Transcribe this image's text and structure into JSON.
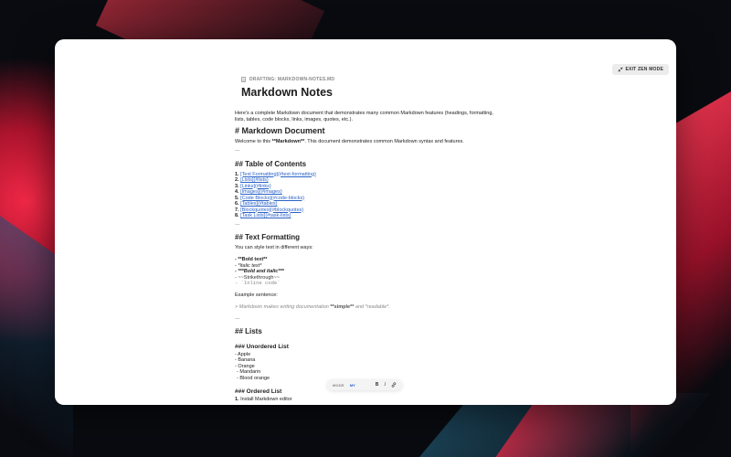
{
  "zen": {
    "label": "EXIT ZEN MODE",
    "icon": "collapse-icon"
  },
  "doc": {
    "drafting": "DRAFTING: MARKDOWN-NOTES.MD",
    "title": "Markdown Notes",
    "intro": "Here's a complete Markdown document that demonstrates many common Markdown features (headings, formatting, lists, tables, code blocks, links, images, quotes, etc.).",
    "h1": "# Markdown Document",
    "welcome_pre": "Welcome to this ",
    "welcome_bold": "**Markdown**",
    "welcome_post": ". This document demonstrates common Markdown syntax and features.",
    "hr": "---",
    "toc_heading": "## Table of Contents",
    "toc": [
      {
        "num": "1.",
        "link": "[Text Formatting](#text-formatting)"
      },
      {
        "num": "2.",
        "link": "[Lists](#lists)"
      },
      {
        "num": "3.",
        "link": "[Links](#links)"
      },
      {
        "num": "4.",
        "link": "[Images](#images)"
      },
      {
        "num": "5.",
        "link": "[Code Blocks](#code-blocks)"
      },
      {
        "num": "6.",
        "link": "[Tables](#tables)"
      },
      {
        "num": "7.",
        "link": "[Blockquotes](#blockquotes)"
      },
      {
        "num": "8.",
        "link": "[Task Lists](#task-lists)"
      }
    ],
    "tf_heading": "## Text Formatting",
    "tf_intro": "You can style text in different ways:",
    "tf_items": {
      "bold": "- **Bold text**",
      "italic": "- *Italic text*",
      "bolditalic": "- ***Bold and italic***",
      "strike": "- ~~Strikethrough~~",
      "code": "- `Inline code`"
    },
    "example": "Example sentence:",
    "quote_pre": "> Markdown makes writing documentation ",
    "quote_bold": "**simple**",
    "quote_post": " and *readable*.",
    "lists_heading": "## Lists",
    "ul_heading": "### Unordered List",
    "ul": [
      "- Apple",
      "- Banana",
      "- Orange",
      "  - Mandarin",
      "  - Blood orange"
    ],
    "ol_heading": "### Ordered List",
    "ol_first_num": "1.",
    "ol_first": "Install Markdown editor"
  },
  "toolbar": {
    "mode_label": "MODE",
    "mode_value": "MY",
    "bold": "B",
    "italic": "I",
    "link_icon": "link-icon"
  }
}
